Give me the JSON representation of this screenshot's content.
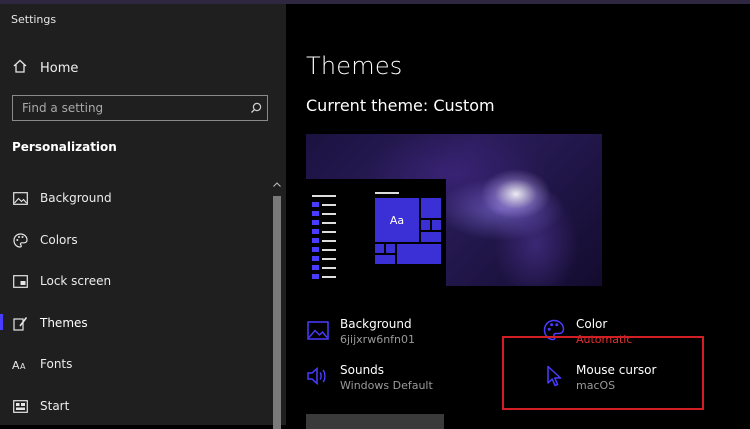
{
  "window": {
    "title": "Settings"
  },
  "sidebar": {
    "home_label": "Home",
    "search_placeholder": "Find a setting",
    "section_title": "Personalization",
    "items": [
      {
        "label": "Background",
        "icon": "image-icon"
      },
      {
        "label": "Colors",
        "icon": "palette-icon"
      },
      {
        "label": "Lock screen",
        "icon": "lock-screen-icon"
      },
      {
        "label": "Themes",
        "icon": "brush-icon",
        "active": true
      },
      {
        "label": "Fonts",
        "icon": "font-icon"
      },
      {
        "label": "Start",
        "icon": "start-icon"
      }
    ]
  },
  "main": {
    "title": "Themes",
    "current_theme": "Current theme: Custom",
    "preview_tile_label": "Aa",
    "properties": {
      "background": {
        "label": "Background",
        "value": "6jijxrw6nfn01"
      },
      "color": {
        "label": "Color",
        "value": "Automatic"
      },
      "sounds": {
        "label": "Sounds",
        "value": "Windows Default"
      },
      "mouse_cursor": {
        "label": "Mouse cursor",
        "value": "macOS"
      }
    }
  },
  "colors": {
    "accent": "#4a3cff",
    "highlight_box": "#d21f26",
    "sidebar_bg": "#1f1f1f",
    "main_bg": "#000000"
  }
}
